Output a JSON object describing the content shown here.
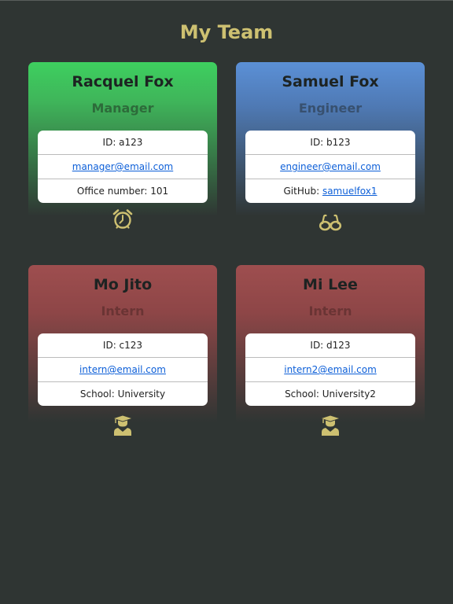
{
  "page": {
    "title": "My Team"
  },
  "cards": [
    {
      "name": "Racquel Fox",
      "role": "Manager",
      "id": "ID: a123",
      "email": "manager@email.com",
      "extra_prefix": "Office number: 101",
      "extra_link": "",
      "icon": "alarm-clock-icon"
    },
    {
      "name": "Samuel Fox",
      "role": "Engineer",
      "id": "ID: b123",
      "email": "engineer@email.com",
      "extra_prefix": "GitHub: ",
      "extra_link": "samuelfox1",
      "icon": "glasses-icon"
    },
    {
      "name": "Mo Jito",
      "role": "Intern",
      "id": "ID: c123",
      "email": "intern@email.com",
      "extra_prefix": "School: University",
      "extra_link": "",
      "icon": "graduate-icon"
    },
    {
      "name": "Mi Lee",
      "role": "Intern",
      "id": "ID: d123",
      "email": "intern2@email.com",
      "extra_prefix": "School: University2",
      "extra_link": "",
      "icon": "graduate-icon"
    }
  ],
  "colors": {
    "background": "#2f3533",
    "title": "#cdc071",
    "icon": "#cdc071",
    "manager_accent": "#3ecf5f",
    "engineer_accent": "#5b90d6",
    "intern_accent": "#9e4e4f",
    "link": "#0d5fd8"
  }
}
